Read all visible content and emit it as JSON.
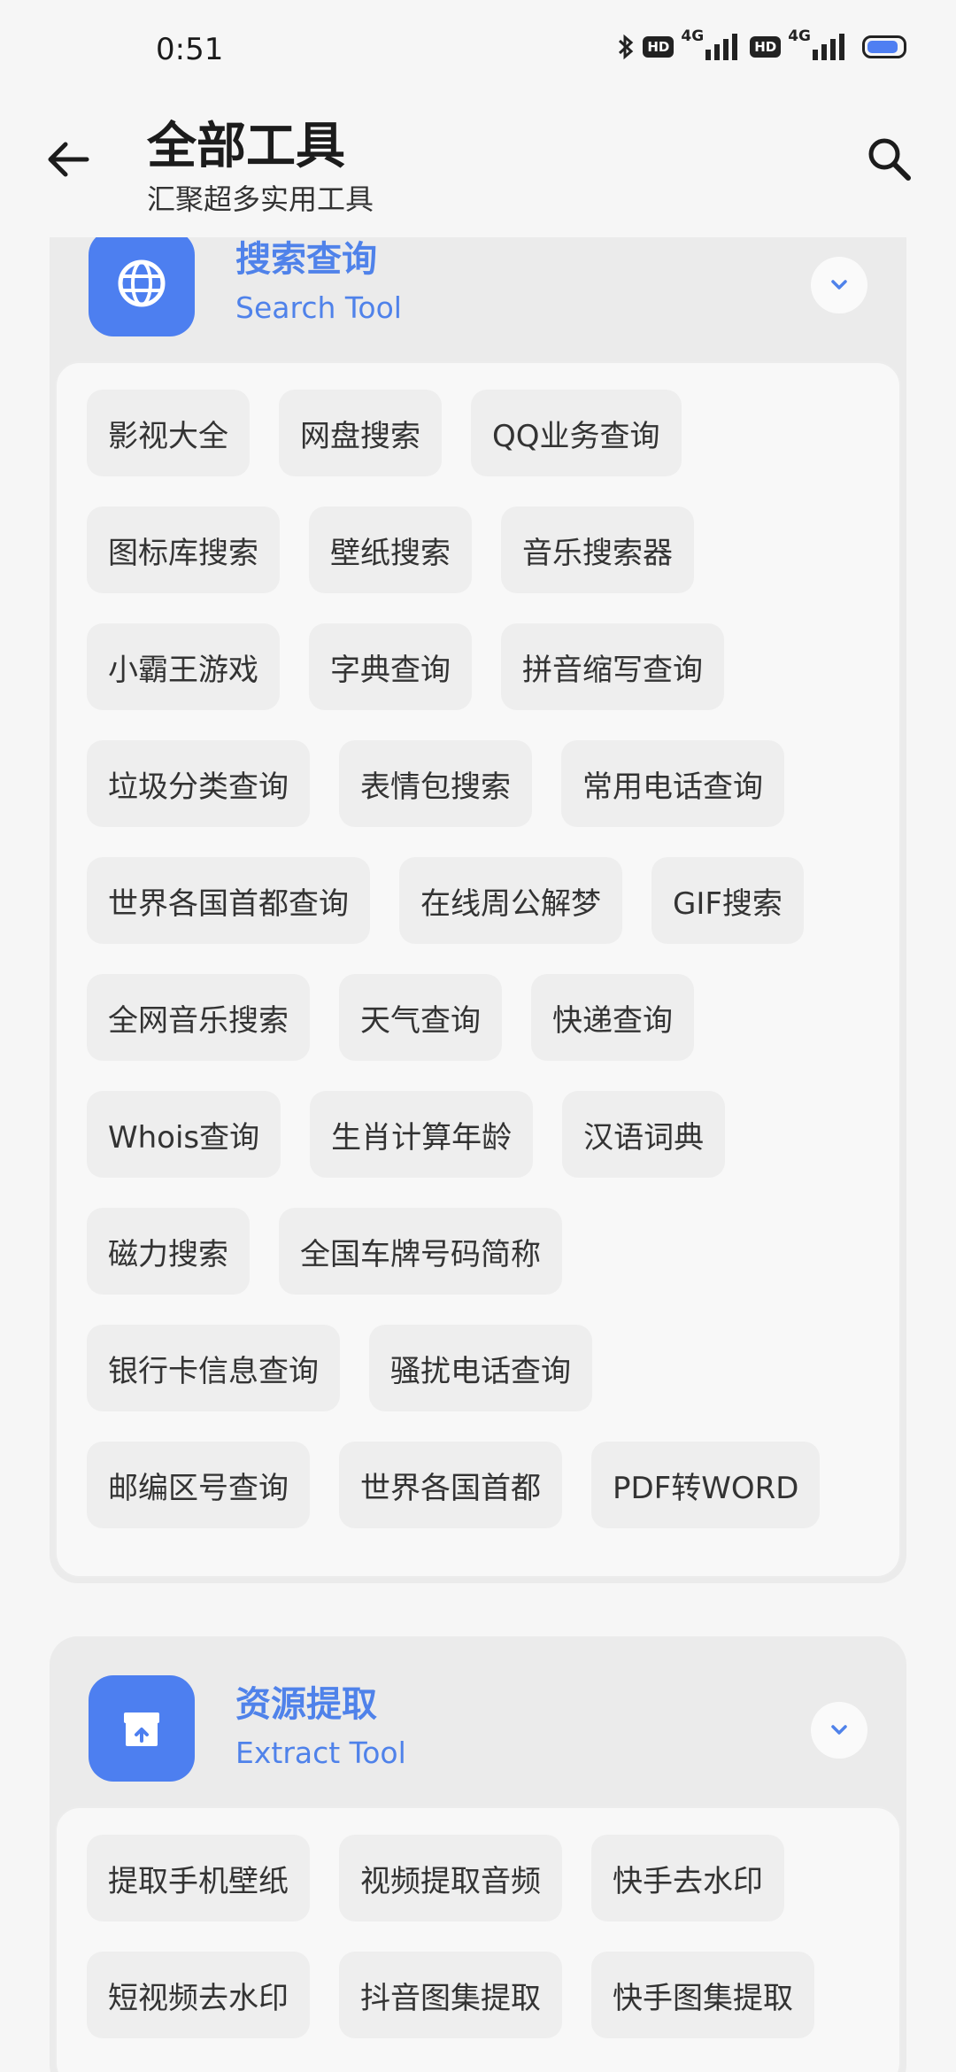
{
  "status_bar": {
    "time": "0:51",
    "hd1": "HD",
    "net1": "4G",
    "hd2": "HD",
    "net2": "4G"
  },
  "header": {
    "title": "全部工具",
    "subtitle": "汇聚超多实用工具"
  },
  "sections": [
    {
      "title": "搜索查询",
      "subtitle": "Search Tool",
      "icon": "globe-icon",
      "tools": [
        "影视大全",
        "网盘搜索",
        "QQ业务查询",
        "图标库搜索",
        "壁纸搜索",
        "音乐搜索器",
        "小霸王游戏",
        "字典查询",
        "拼音缩写查询",
        "垃圾分类查询",
        "表情包搜索",
        "常用电话查询",
        "世界各国首都查询",
        "在线周公解梦",
        "GIF搜索",
        "全网音乐搜索",
        "天气查询",
        "快递查询",
        "Whois查询",
        "生肖计算年龄",
        "汉语词典",
        "磁力搜索",
        "全国车牌号码简称",
        "银行卡信息查询",
        "骚扰电话查询",
        "邮编区号查询",
        "世界各国首都",
        "PDF转WORD"
      ]
    },
    {
      "title": "资源提取",
      "subtitle": "Extract Tool",
      "icon": "archive-box-icon",
      "tools": [
        "提取手机壁纸",
        "视频提取音频",
        "快手去水印",
        "短视频去水印",
        "抖音图集提取",
        "快手图集提取"
      ]
    }
  ],
  "colors": {
    "accent": "#4f82ea",
    "icon_bg": "#4d7ff0",
    "page_bg": "#f6f6f6"
  }
}
